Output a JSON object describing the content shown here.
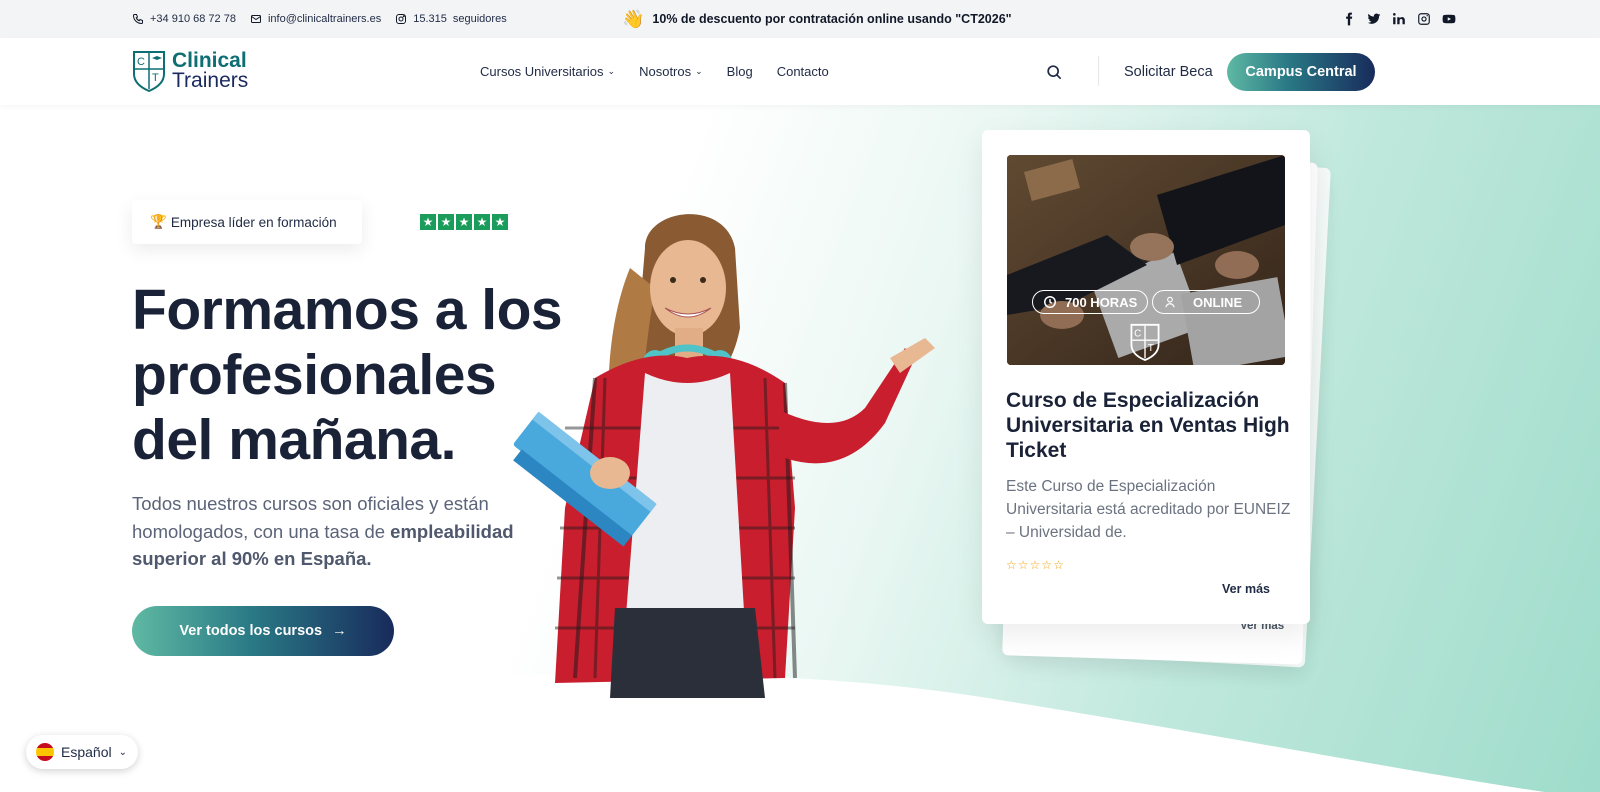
{
  "topbar": {
    "phone": "+34 910 68 72 78",
    "email": "info@clinicaltrainers.es",
    "instagram_count": "15.315",
    "instagram_label": "seguidores",
    "promo": "10% de descuento por contratación online usando \"CT2026\"",
    "social": [
      "facebook-icon",
      "twitter-icon",
      "linkedin-icon",
      "instagram-icon",
      "youtube-icon"
    ]
  },
  "header": {
    "logo_line1": "Clinical",
    "logo_line2": "Trainers",
    "nav": [
      {
        "label": "Cursos Universitarios",
        "has_dropdown": true
      },
      {
        "label": "Nosotros",
        "has_dropdown": true
      },
      {
        "label": "Blog",
        "has_dropdown": false
      },
      {
        "label": "Contacto",
        "has_dropdown": false
      }
    ],
    "beca": "Solicitar Beca",
    "campus": "Campus Central"
  },
  "hero": {
    "badge": "Empresa líder en formación",
    "rating_stars": 5,
    "headline": "Formamos a los profesionales del mañana.",
    "sub_plain": "Todos nuestros cursos son oficiales y están homologados, con una tasa de ",
    "sub_bold": "empleabilidad superior al 90% en España.",
    "cta": "Ver todos los cursos"
  },
  "card": {
    "hours": "700 HORAS",
    "mode": "ONLINE",
    "title": "Curso de Especialización Universitaria en Ventas High Ticket",
    "description": "Este Curso de Especialización Universitaria está acreditado por EUNEIZ – Universidad de.",
    "rating": 0,
    "ver_mas": "Ver más",
    "back_ver_mas": "Ver más"
  },
  "language": {
    "selected": "Español"
  },
  "colors": {
    "brand_teal": "#5fb9a3",
    "brand_navy": "#182b5c",
    "trustpilot_green": "#1a9c5a"
  }
}
